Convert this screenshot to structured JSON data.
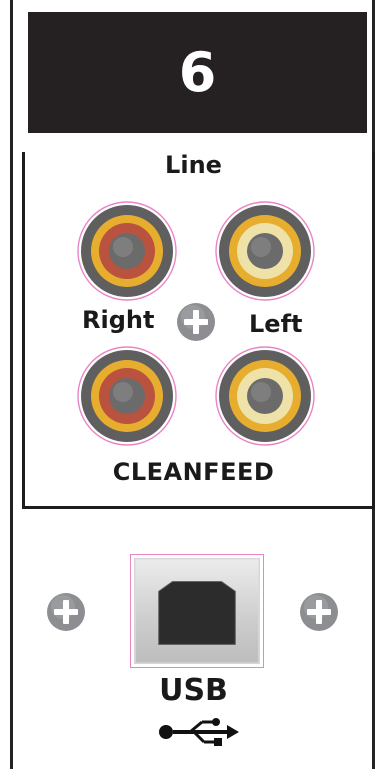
{
  "channel": {
    "number": "6"
  },
  "labels": {
    "line": "Line",
    "right": "Right",
    "left": "Left",
    "cleanfeed": "CLEANFEED",
    "usb": "USB"
  },
  "jacks": {
    "line_right": {
      "color": "#b9523e"
    },
    "line_left": {
      "color": "#efe2a8"
    },
    "cleanfeed_right": {
      "color": "#b9523e"
    },
    "cleanfeed_left": {
      "color": "#efe2a8"
    }
  },
  "colors": {
    "panel_dark": "#252122",
    "ring_outer": "#5f5f60",
    "ring_gold": "#e7ad2e",
    "pin": "#6b6b6b",
    "outline_magenta": "#ea84c6",
    "screw": "#8d8e91"
  },
  "icons": {
    "usb": "usb-icon",
    "screw": "screw-icon"
  }
}
